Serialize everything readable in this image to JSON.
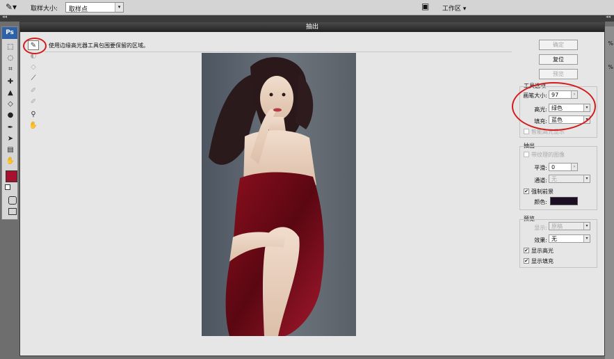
{
  "options_bar": {
    "sample_size_label": "取样大小:",
    "sample_size_value": "取样点",
    "workspace_label": "工作区 ▾"
  },
  "panel_tab": {
    "left": "◂◂",
    "right": "◂◂"
  },
  "palette": {
    "app_logo": "Ps",
    "foreground_color": "#a5112f"
  },
  "right_edge": {
    "zoom_top": "%",
    "zoom_bottom": "%"
  },
  "dialog": {
    "title": "抽出",
    "instruction": "使用边缘高光器工具包围要保留的区域。",
    "buttons": {
      "ok": "确定",
      "reset": "复位",
      "preview": "预览"
    },
    "tool_options": {
      "title": "工具选项",
      "brush_size_label": "画笔大小:",
      "brush_size_value": "97",
      "highlight_label": "高光:",
      "highlight_value": "绿色",
      "fill_label": "填充:",
      "fill_value": "蓝色",
      "smart_highlight_label": "智能高光显示"
    },
    "extraction": {
      "title": "抽出",
      "textured_label": "带纹理的图像",
      "smooth_label": "平滑:",
      "smooth_value": "0",
      "channel_label": "通道:",
      "channel_value": "无",
      "force_fg_label": "强制前景",
      "color_label": "颜色:",
      "color_value": "#1c0f24"
    },
    "preview_group": {
      "title": "预览",
      "show_label": "显示:",
      "show_value": "原稿",
      "effect_label": "效果:",
      "effect_value": "无",
      "show_highlight_label": "显示高光",
      "show_fill_label": "显示填充"
    }
  }
}
